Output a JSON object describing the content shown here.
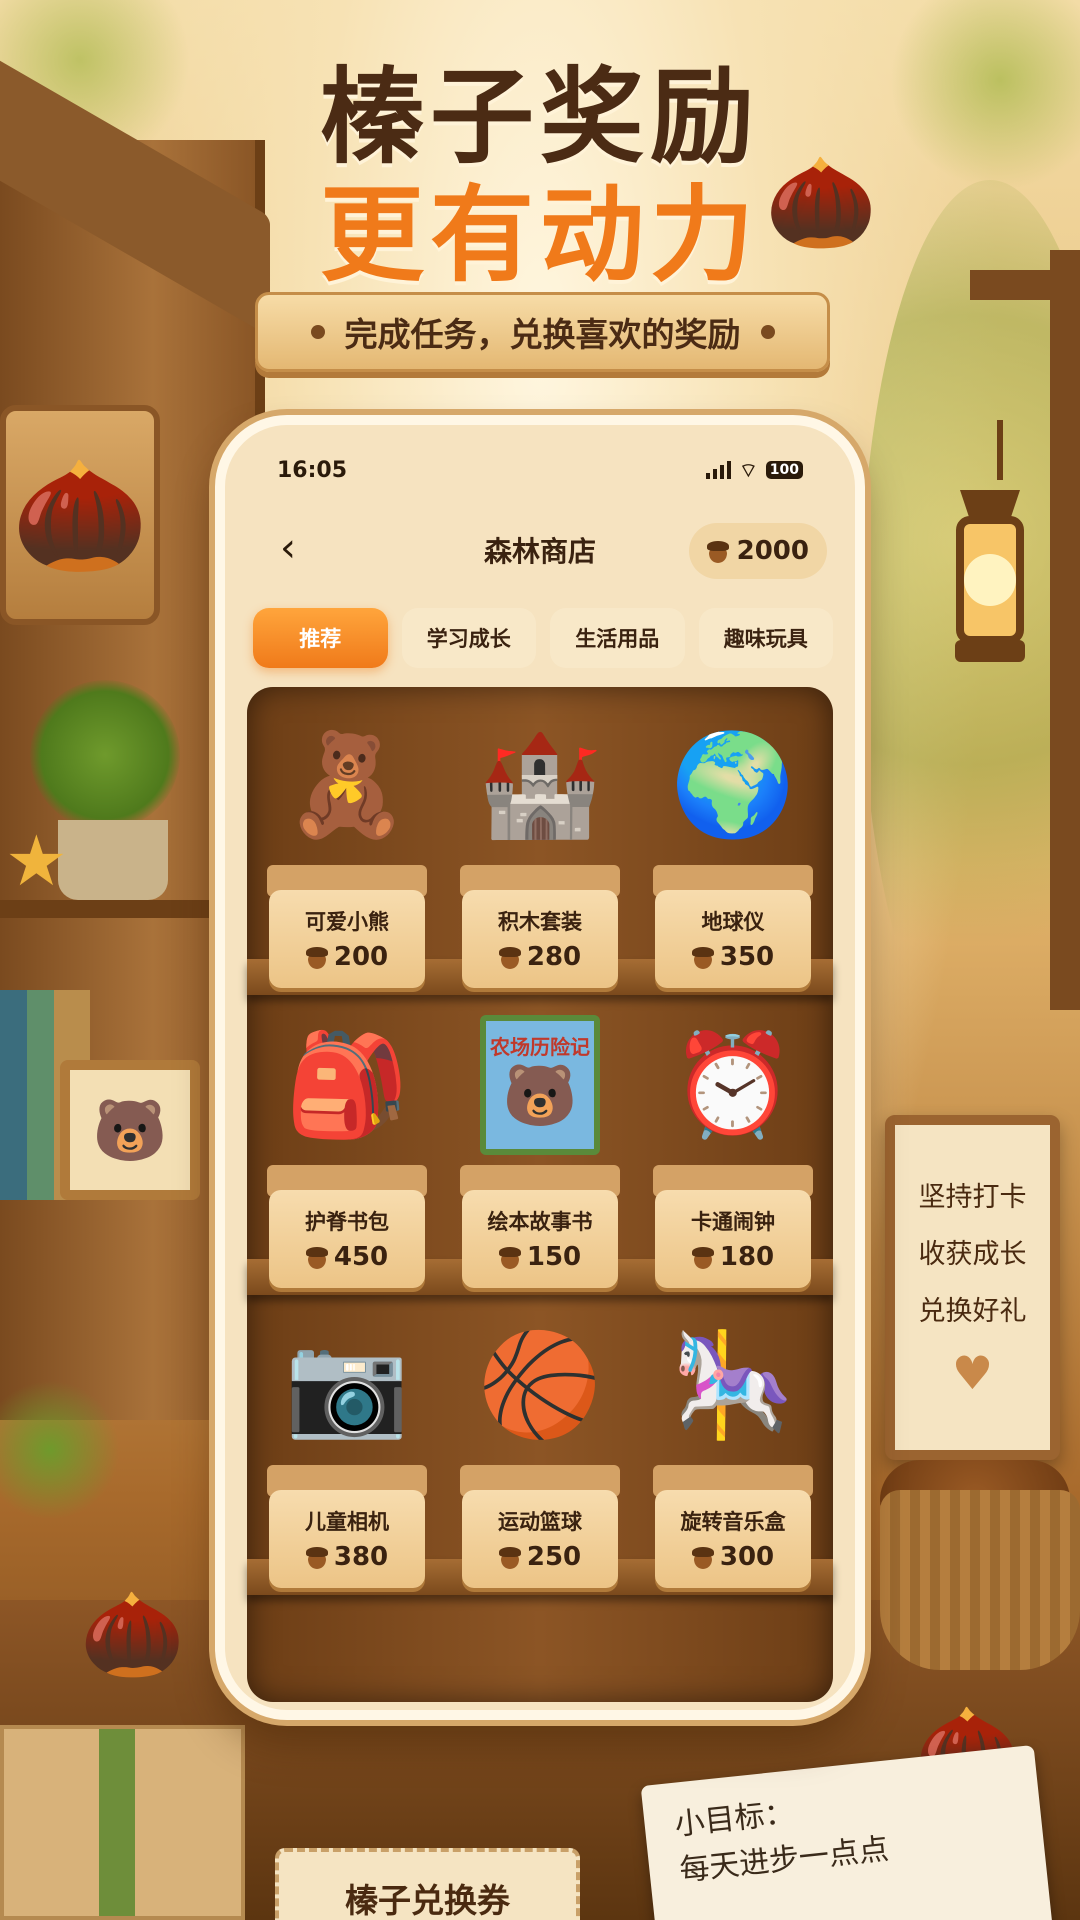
{
  "hero": {
    "title": "榛子奖励",
    "subtitle": "更有动力",
    "banner": "完成任务，兑换喜欢的奖励"
  },
  "status_bar": {
    "time": "16:05",
    "battery": "100"
  },
  "nav": {
    "back_label": "‹",
    "title": "森林商店",
    "balance": "2000"
  },
  "tabs": [
    {
      "label": "推荐",
      "active": true
    },
    {
      "label": "学习成长",
      "active": false
    },
    {
      "label": "生活用品",
      "active": false
    },
    {
      "label": "趣味玩具",
      "active": false
    }
  ],
  "items": [
    {
      "name": "可爱小熊",
      "price": "200",
      "icon": "teddy-bear"
    },
    {
      "name": "积木套装",
      "price": "280",
      "icon": "building-blocks"
    },
    {
      "name": "地球仪",
      "price": "350",
      "icon": "globe"
    },
    {
      "name": "护脊书包",
      "price": "450",
      "icon": "backpack"
    },
    {
      "name": "绘本故事书",
      "price": "150",
      "icon": "picture-book"
    },
    {
      "name": "卡通闹钟",
      "price": "180",
      "icon": "alarm-clock"
    },
    {
      "name": "儿童相机",
      "price": "380",
      "icon": "camera"
    },
    {
      "name": "运动篮球",
      "price": "250",
      "icon": "basketball"
    },
    {
      "name": "旋转音乐盒",
      "price": "300",
      "icon": "carousel-music-box"
    }
  ],
  "decor": {
    "book_title": "农场历险记",
    "board_lines": [
      "坚持打卡",
      "收获成长",
      "兑换好礼"
    ],
    "ticket": "榛子兑换券",
    "note_lines": [
      "小目标：",
      "每天进步一点点"
    ]
  },
  "colors": {
    "accent": "#f07a1a",
    "title_brown": "#4b2b14",
    "wood": "#8c5525"
  }
}
